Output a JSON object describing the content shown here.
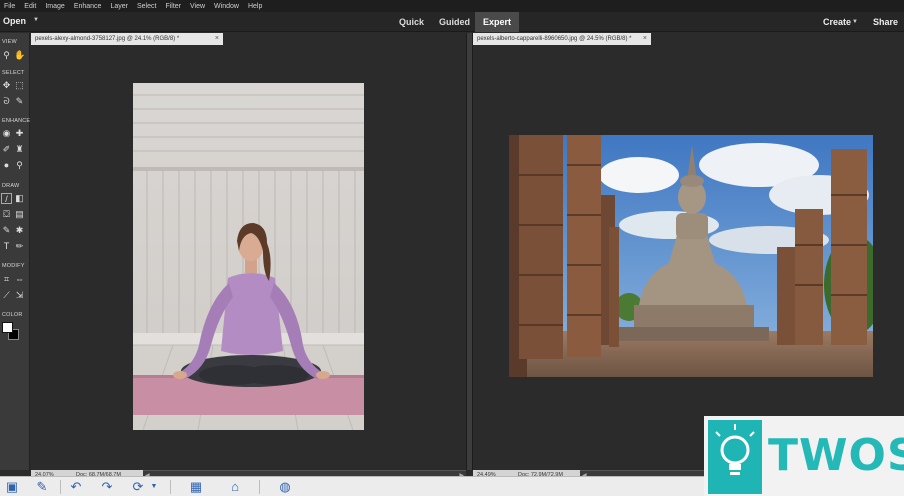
{
  "menu": [
    "File",
    "Edit",
    "Image",
    "Enhance",
    "Layer",
    "Select",
    "Filter",
    "View",
    "Window",
    "Help"
  ],
  "modebar": {
    "open": "Open",
    "modes": [
      {
        "label": "Quick",
        "active": false
      },
      {
        "label": "Guided",
        "active": false
      },
      {
        "label": "Expert",
        "active": true
      }
    ],
    "create": "Create",
    "share": "Share"
  },
  "toolbox": {
    "sections": [
      "VIEW",
      "SELECT",
      "ENHANCE",
      "DRAW",
      "MODIFY",
      "COLOR"
    ],
    "tools": [
      "zoom-tool",
      "hand-tool",
      "move-tool",
      "marquee-tool",
      "lasso-tool",
      "quick-selection-tool",
      "eye-tool",
      "spot-healing-tool",
      "smart-brush-tool",
      "clone-stamp-tool",
      "blur-tool",
      "sponge-tool",
      "brush-tool",
      "eraser-tool",
      "paint-bucket-tool",
      "gradient-tool",
      "color-replacement-tool",
      "custom-shape-tool",
      "type-tool",
      "pencil-tool",
      "crop-tool",
      "recompose-tool",
      "straighten-tool",
      "content-aware-move-tool"
    ],
    "foreground_color": "#ffffff",
    "background_color": "#000000"
  },
  "documents": [
    {
      "tab": "pexels-alexy-almond-3758127.jpg @ 24.1% (RGB/8) *",
      "zoom": "24.07%",
      "doc_size": "Doc: 68.7M/68.7M"
    },
    {
      "tab": "pexels-alberto-capparelli-8960650.jpg @ 24.5% (RGB/8) *",
      "zoom": "24.49%",
      "doc_size": "Doc: 72.9M/72.9M"
    }
  ],
  "taskbar": {
    "icons": [
      "photo-bin-icon",
      "tool-options-icon",
      "undo-icon",
      "redo-icon",
      "rotate-icon",
      "layout-icon",
      "organizer-icon",
      "home-screen-icon",
      "help-icon"
    ]
  },
  "watermark": {
    "brand": "TWOS"
  }
}
